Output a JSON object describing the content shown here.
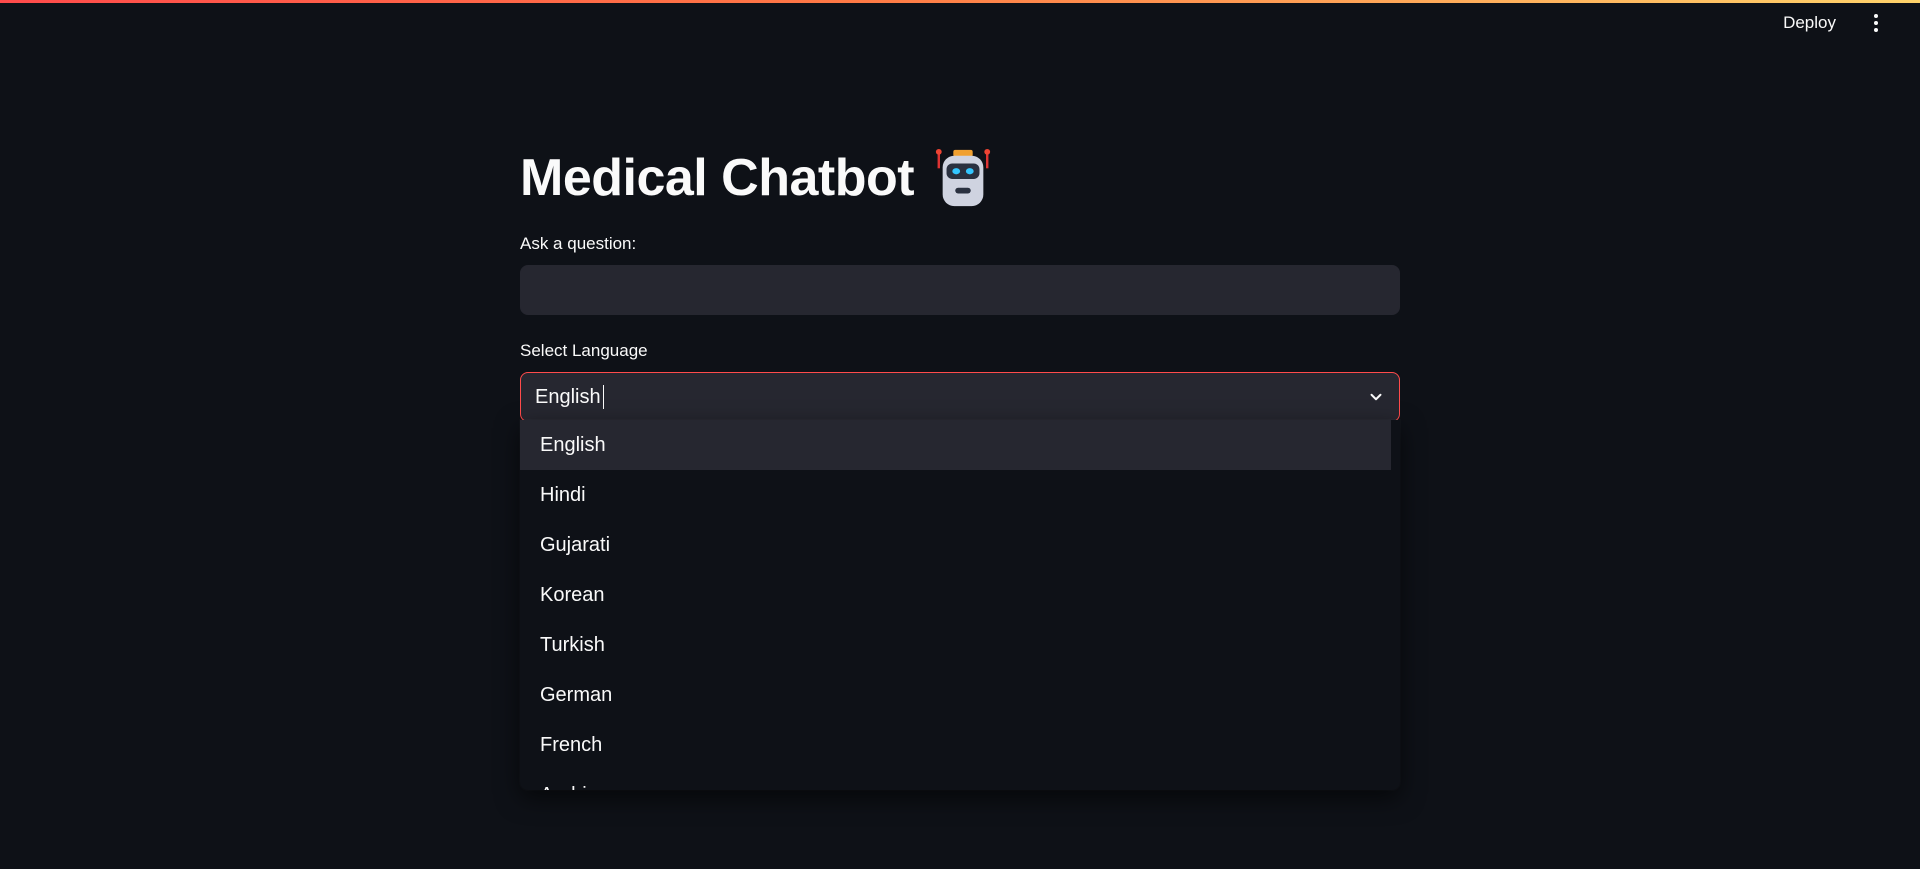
{
  "header": {
    "deploy_label": "Deploy",
    "menu_icon": "more-vertical-icon"
  },
  "main": {
    "title": "Medical Chatbot",
    "title_icon": "robot-icon",
    "question": {
      "label": "Ask a question:",
      "value": "",
      "placeholder": ""
    },
    "language": {
      "label": "Select Language",
      "selected": "English",
      "options": [
        "English",
        "Hindi",
        "Gujarati",
        "Korean",
        "Turkish",
        "German",
        "French",
        "Arabic"
      ]
    }
  },
  "colors": {
    "background": "#0e1117",
    "input_bg": "#262730",
    "accent": "#ff4b4b",
    "text": "#fafafa"
  }
}
